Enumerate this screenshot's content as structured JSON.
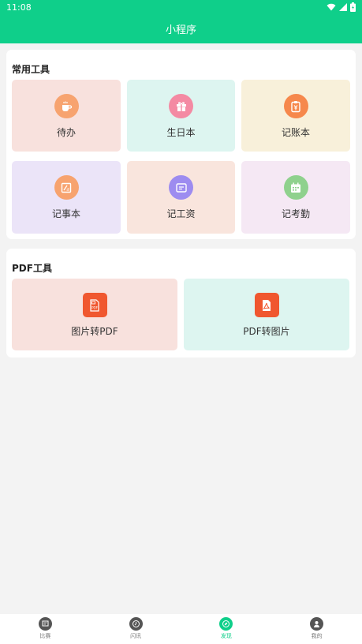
{
  "status_bar": {
    "time": "11:08"
  },
  "header": {
    "title": "小程序"
  },
  "common_tools": {
    "title": "常用工具",
    "items": [
      {
        "label": "待办",
        "icon": "coffee-icon",
        "bg": "#f8e1dd",
        "icon_color": "#f7a36f"
      },
      {
        "label": "生日本",
        "icon": "gift-icon",
        "bg": "#ddf5f0",
        "icon_color": "#f48aa3"
      },
      {
        "label": "记账本",
        "icon": "ledger-icon",
        "bg": "#f8f0da",
        "icon_color": "#f6884c"
      },
      {
        "label": "记事本",
        "icon": "notebook-icon",
        "bg": "#ebe4f8",
        "icon_color": "#f7a36f"
      },
      {
        "label": "记工资",
        "icon": "wallet-icon",
        "bg": "#f9e5dd",
        "icon_color": "#9d8cf0"
      },
      {
        "label": "记考勤",
        "icon": "calendar-icon",
        "bg": "#f5e8f4",
        "icon_color": "#8fd18d"
      }
    ]
  },
  "pdf_tools": {
    "title": "PDF工具",
    "items": [
      {
        "label": "图片转PDF",
        "icon": "image-to-pdf-icon",
        "bg": "#f8e1dd",
        "icon_color": "#f0572f"
      },
      {
        "label": "PDF转图片",
        "icon": "pdf-file-icon",
        "bg": "#ddf5f0",
        "icon_color": "#f0572f"
      }
    ]
  },
  "bottom_nav": {
    "items": [
      {
        "label": "比赛",
        "icon": "trophy-icon",
        "active": false
      },
      {
        "label": "闪讯",
        "icon": "clock-icon",
        "active": false
      },
      {
        "label": "发现",
        "icon": "compass-icon",
        "active": true
      },
      {
        "label": "我的",
        "icon": "user-icon",
        "active": false
      }
    ]
  },
  "colors": {
    "brand": "#0fcf8a",
    "background": "#f3f3f3"
  }
}
